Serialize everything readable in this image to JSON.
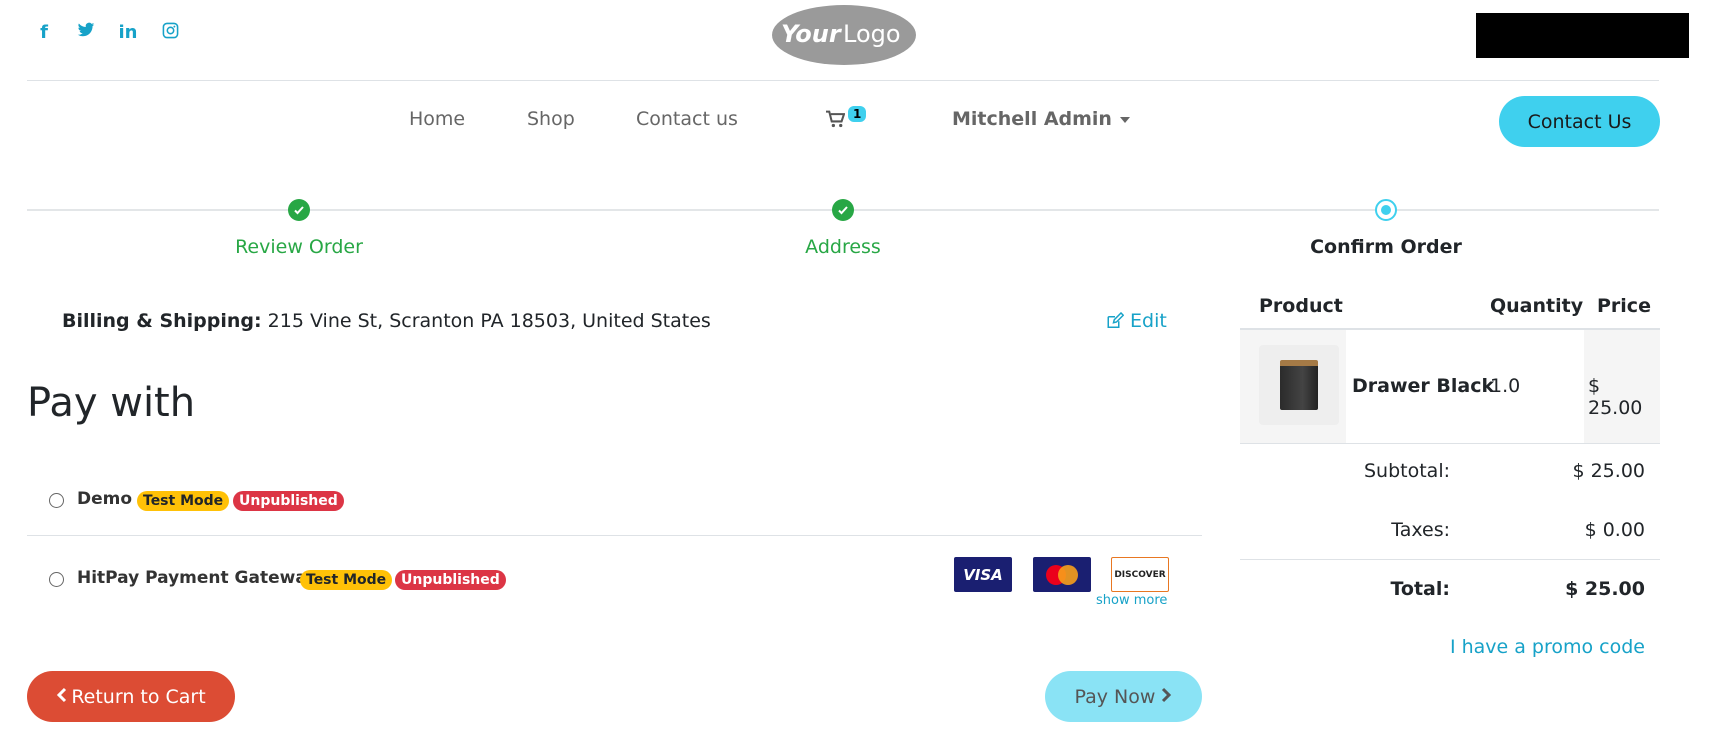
{
  "header": {
    "social": [
      {
        "icon": "facebook-icon",
        "glyph": "f"
      },
      {
        "icon": "twitter-icon",
        "glyph": "t"
      },
      {
        "icon": "linkedin-icon",
        "glyph": "in"
      },
      {
        "icon": "instagram-icon",
        "glyph": "◎"
      }
    ],
    "logo_text_a": "Your",
    "logo_text_b": "Logo"
  },
  "nav": {
    "home": "Home",
    "shop": "Shop",
    "contact": "Contact us",
    "cart_count": "1",
    "user": "Mitchell Admin",
    "contact_button": "Contact Us"
  },
  "steps": {
    "review": "Review Order",
    "address": "Address",
    "confirm": "Confirm Order"
  },
  "billing": {
    "label": "Billing & Shipping:",
    "address": "215 Vine St, Scranton PA 18503, United States",
    "edit": "Edit"
  },
  "payment": {
    "title": "Pay with",
    "options": [
      {
        "name": "Demo",
        "test_badge": "Test Mode",
        "status_badge": "Unpublished"
      },
      {
        "name": "HitPay Payment Gateway",
        "test_badge": "Test Mode",
        "status_badge": "Unpublished"
      }
    ],
    "cards": {
      "visa": "VISA",
      "discover": "DISCOVER"
    },
    "show_more": "show more"
  },
  "actions": {
    "return": "Return to Cart",
    "pay_now": "Pay Now"
  },
  "summary": {
    "headers": {
      "product": "Product",
      "quantity": "Quantity",
      "price": "Price"
    },
    "items": [
      {
        "name": "Drawer Black",
        "quantity": "1.0",
        "price": "$ 25.00"
      }
    ],
    "subtotal_label": "Subtotal:",
    "subtotal": "$ 25.00",
    "taxes_label": "Taxes:",
    "taxes": "$ 0.00",
    "total_label": "Total:",
    "total": "$ 25.00",
    "promo": "I have a promo code"
  },
  "colors": {
    "accent": "#3fd0ee",
    "success": "#28a745",
    "danger": "#dc4c34",
    "link": "#17a2c8",
    "warning": "#ffc107"
  }
}
